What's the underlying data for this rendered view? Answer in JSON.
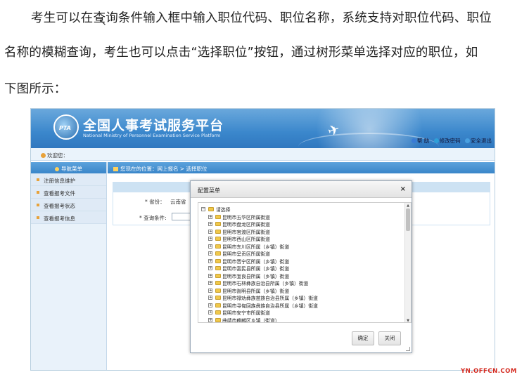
{
  "article": {
    "line1": "考生可以在查询条件输入框中输入职位代码、职位名称，系统支持对职位代码、职位",
    "line2": "名称的模糊查询，考生也可以点击“选择职位”按钮，通过树形菜单选择对应的职位，如",
    "line3": "下图所示："
  },
  "header": {
    "logo_text": "PTA",
    "title": "全国人事考试服务平台",
    "subtitle": "National Ministry of Personnel Examination Service Platform",
    "links": [
      "帮 助",
      "修改密码",
      "安全退出"
    ]
  },
  "welcome": "欢迎您：",
  "sidebar": {
    "heading": "导航菜单",
    "items": [
      "注册信息维护",
      "查看报考文件",
      "查看报考状态",
      "查看报考信息"
    ]
  },
  "breadcrumb": "您现在的位置：网上报名 > 选择职位",
  "form": {
    "province_label": "* 省份：",
    "province_value": "云南省",
    "query_label": "* 查询条件:"
  },
  "dialog": {
    "title": "配置菜单",
    "close": "×",
    "root": "请选择",
    "nodes": [
      "昆明市五华区所属街道",
      "昆明市盘龙区所属街道",
      "昆明市官渡区所属街道",
      "昆明市西山区所属街道",
      "昆明市东川区所属（乡镇）街道",
      "昆明市呈贡区所属街道",
      "昆明市晋宁区所属（乡镇）街道",
      "昆明市富民县所属（乡镇）街道",
      "昆明市宜良县所属（乡镇）街道",
      "昆明市石林彝族自治县所属（乡镇）街道",
      "昆明市嵩明县所属（乡镇）街道",
      "昆明市禄劝彝族苗族自治县所属（乡镇）街道",
      "昆明市寻甸回族彝族自治县所属（乡镇）街道",
      "昆明市安宁市所属街道",
      "曲靖市麒麟区乡镇（街道）"
    ],
    "ok": "确定",
    "close_btn": "关闭"
  },
  "watermark": "YN.OFFCN.COM",
  "colors": {
    "header_blue": "#3b87cc",
    "folder": "#f0c84a",
    "watermark": "#d4281e"
  }
}
